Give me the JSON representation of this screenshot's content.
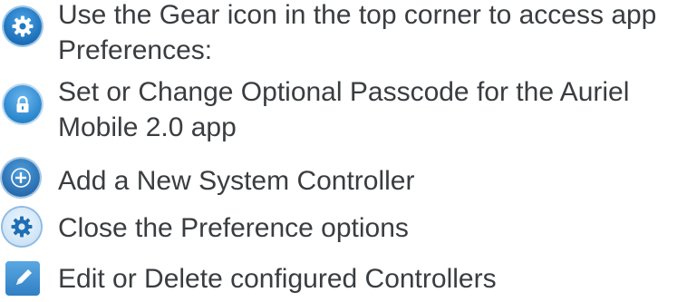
{
  "items": [
    {
      "icon": "gear-icon",
      "text": "Use the Gear icon in the top corner to access app\nPreferences:"
    },
    {
      "icon": "lock-icon",
      "text": "Set or Change Optional Passcode for the Auriel\nMobile 2.0 app"
    },
    {
      "icon": "plus-icon",
      "text": "Add a New System Controller"
    },
    {
      "icon": "gear-icon",
      "text": "Close the Preference options"
    },
    {
      "icon": "pencil-icon",
      "text": "Edit or Delete configured Controllers"
    }
  ],
  "colors": {
    "text": "#3a3d40",
    "accent_blue": "#2a7fc8"
  }
}
